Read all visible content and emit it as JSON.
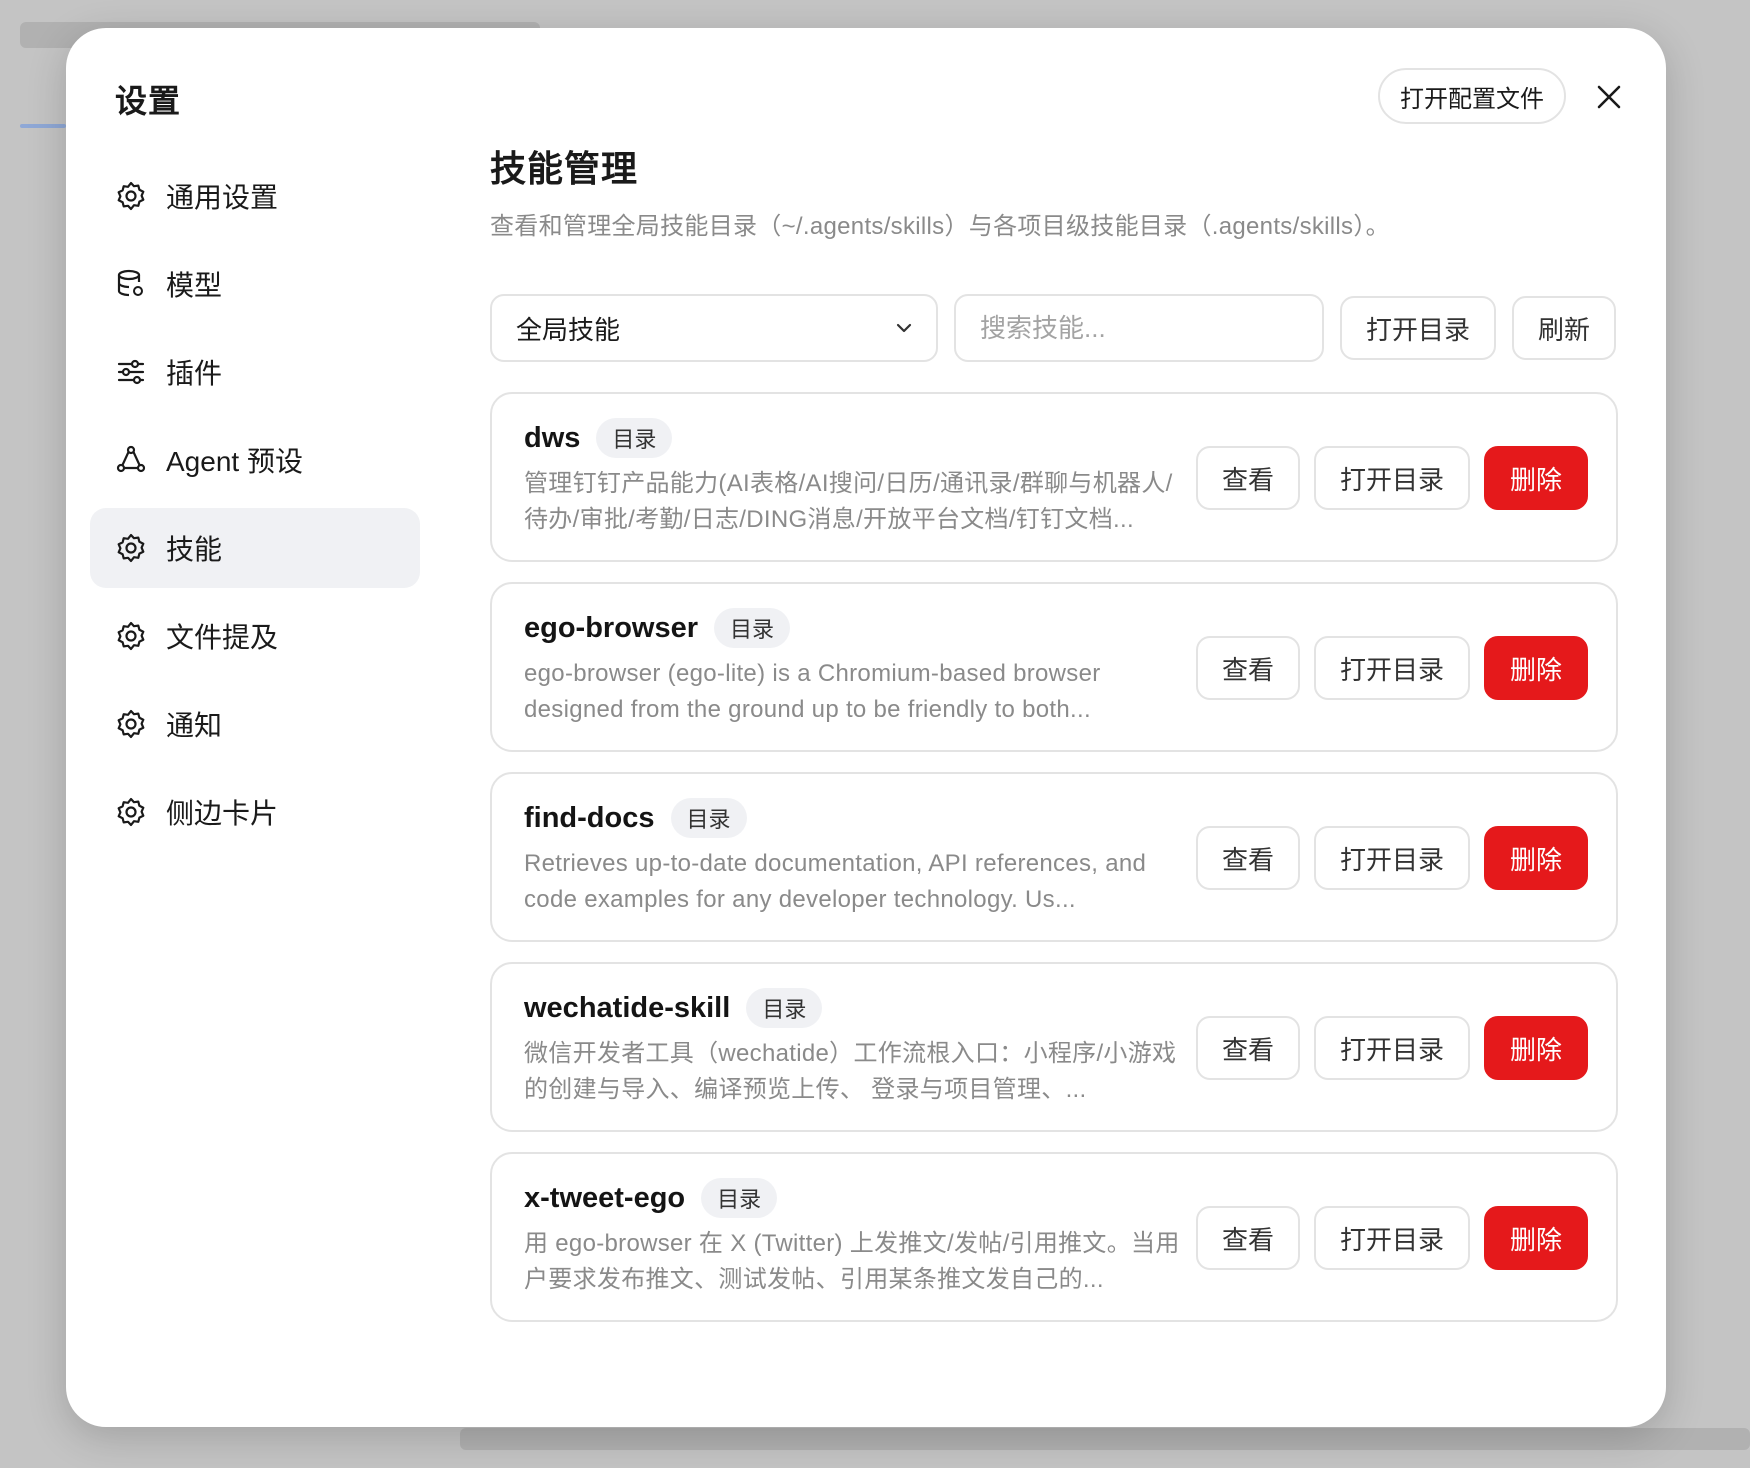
{
  "modal": {
    "title": "设置",
    "open_config_label": "打开配置文件",
    "close_icon": "close-icon"
  },
  "sidebar": {
    "items": [
      {
        "label": "通用设置",
        "icon": "gear-icon",
        "active": false
      },
      {
        "label": "模型",
        "icon": "database-icon",
        "active": false
      },
      {
        "label": "插件",
        "icon": "sliders-icon",
        "active": false
      },
      {
        "label": "Agent 预设",
        "icon": "agent-icon",
        "active": false
      },
      {
        "label": "技能",
        "icon": "gear-icon",
        "active": true
      },
      {
        "label": "文件提及",
        "icon": "gear-icon",
        "active": false
      },
      {
        "label": "通知",
        "icon": "gear-icon",
        "active": false
      },
      {
        "label": "侧边卡片",
        "icon": "gear-icon",
        "active": false
      }
    ]
  },
  "main": {
    "title": "技能管理",
    "description": "查看和管理全局技能目录（~/.agents/skills）与各项目级技能目录（.agents/skills）。",
    "toolbar": {
      "scope_selected": "全局技能",
      "search_placeholder": "搜索技能...",
      "open_dir_label": "打开目录",
      "refresh_label": "刷新"
    },
    "skills": [
      {
        "name": "dws",
        "tag": "目录",
        "description": "管理钉钉产品能力(AI表格/AI搜问/日历/通讯录/群聊与机器人/待办/审批/考勤/日志/DING消息/开放平台文档/钉钉文档...",
        "view_label": "查看",
        "open_label": "打开目录",
        "delete_label": "删除"
      },
      {
        "name": "ego-browser",
        "tag": "目录",
        "description": "ego-browser (ego-lite) is a Chromium-based browser designed from the ground up to be friendly to both...",
        "view_label": "查看",
        "open_label": "打开目录",
        "delete_label": "删除"
      },
      {
        "name": "find-docs",
        "tag": "目录",
        "description": "Retrieves up-to-date documentation, API references, and code examples for any developer technology. Us...",
        "view_label": "查看",
        "open_label": "打开目录",
        "delete_label": "删除"
      },
      {
        "name": "wechatide-skill",
        "tag": "目录",
        "description": "微信开发者工具（wechatide）工作流根入口：小程序/小游戏的创建与导入、编译预览上传、 登录与项目管理、...",
        "view_label": "查看",
        "open_label": "打开目录",
        "delete_label": "删除"
      },
      {
        "name": "x-tweet-ego",
        "tag": "目录",
        "description": "用 ego-browser 在 X (Twitter) 上发推文/发帖/引用推文。当用户要求发布推文、测试发帖、引用某条推文发自己的...",
        "view_label": "查看",
        "open_label": "打开目录",
        "delete_label": "删除"
      }
    ]
  },
  "colors": {
    "danger": "#e5191b",
    "active_nav_bg": "#f0f1f4",
    "muted_text": "#8a8a8a"
  }
}
